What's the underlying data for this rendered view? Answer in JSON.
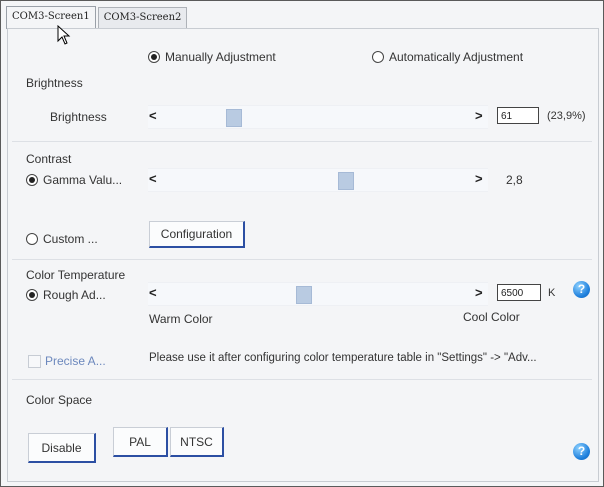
{
  "tabs": [
    {
      "label": "COM3-Screen1",
      "active": true
    },
    {
      "label": "COM3-Screen2",
      "active": false
    }
  ],
  "mode": {
    "manual_label": "Manually Adjustment",
    "auto_label": "Automatically Adjustment",
    "selected": "manual"
  },
  "brightness": {
    "section_title": "Brightness",
    "row_label": "Brightness",
    "left_arrow": "<",
    "right_arrow": ">",
    "value": "61",
    "percent": "(23,9%)",
    "slider_fraction": 0.239
  },
  "contrast": {
    "section_title": "Contrast",
    "gamma_label": "Gamma Valu...",
    "gamma_selected": true,
    "left_arrow": "<",
    "right_arrow": ">",
    "gamma_value": "2,8",
    "custom_label": "Custom ...",
    "configuration_button": "Configuration"
  },
  "color_temperature": {
    "section_title": "Color Temperature",
    "rough_label": "Rough Ad...",
    "rough_selected": true,
    "left_arrow": "<",
    "right_arrow": ">",
    "value": "6500",
    "unit": "K",
    "warm_label": "Warm Color",
    "cool_label": "Cool Color",
    "help": "?"
  },
  "precise": {
    "label": "Precise A...",
    "message": "Please use it after configuring color temperature table in \"Settings\" -> \"Adv..."
  },
  "color_space": {
    "section_title": "Color Space",
    "buttons": [
      "Disable",
      "PAL",
      "NTSC"
    ],
    "help": "?"
  },
  "colors": {
    "accent_blue": "#2c4fa3",
    "help_blue": "#1e7fdc",
    "slider_thumb": "#b9cbe2"
  }
}
